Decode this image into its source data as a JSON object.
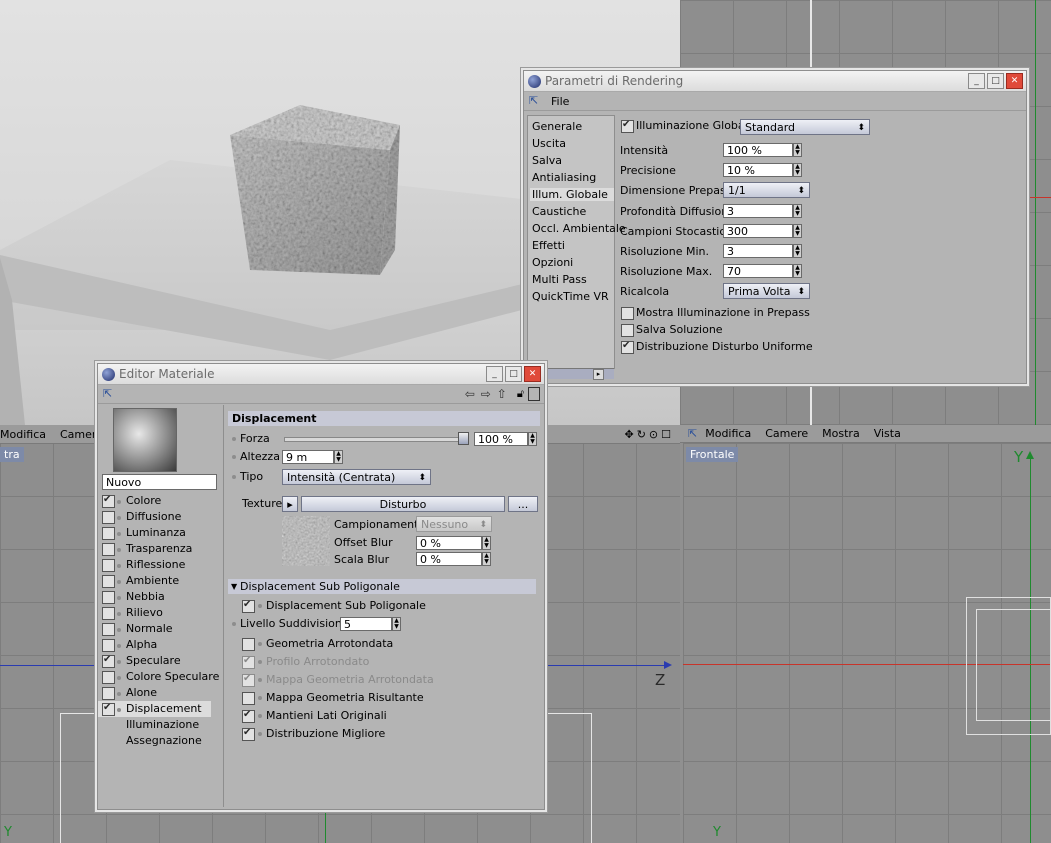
{
  "viewports": {
    "left_bottom": {
      "menu": [
        "Modifica",
        "Camere"
      ],
      "tag": "tra",
      "axis_z": "Z",
      "axis_y": "Y"
    },
    "right_bottom": {
      "menu": [
        "Modifica",
        "Camere",
        "Mostra",
        "Vista"
      ],
      "tag": "Frontale",
      "axis_y": "Y",
      "axis_y_bottom": "Y"
    },
    "right_top": {
      "axis_y": "Y"
    }
  },
  "render_settings": {
    "title": "Parametri di Rendering",
    "menu_file": "File",
    "sidebar": [
      "Generale",
      "Uscita",
      "Salva",
      "Antialiasing",
      "Illum. Globale",
      "Caustiche",
      "Occl. Ambientale",
      "Effetti",
      "Opzioni",
      "Multi Pass",
      "QuickTime VR"
    ],
    "gi_checkbox": "Illuminazione Globale",
    "gi_mode": "Standard",
    "rows": [
      {
        "label": "Intensità",
        "value": "100 %"
      },
      {
        "label": "Precisione",
        "value": "10 %"
      },
      {
        "label": "Dimensione Prepass",
        "value": "1/1"
      },
      {
        "label": "Profondità Diffusione",
        "value": "3"
      },
      {
        "label": "Campioni Stocastici",
        "value": "300"
      },
      {
        "label": "Risoluzione Min.",
        "value": "3"
      },
      {
        "label": "Risoluzione Max.",
        "value": "70"
      },
      {
        "label": "Ricalcola",
        "value": "Prima Volta"
      }
    ],
    "checks": [
      {
        "label": "Mostra Illuminazione in Prepass",
        "checked": false
      },
      {
        "label": "Salva Soluzione",
        "checked": false
      },
      {
        "label": "Distribuzione Disturbo Uniforme",
        "checked": true
      }
    ]
  },
  "material_editor": {
    "title": "Editor Materiale",
    "name": "Nuovo",
    "channels": [
      {
        "label": "Colore",
        "checked": true,
        "box": true
      },
      {
        "label": "Diffusione",
        "checked": false,
        "box": true
      },
      {
        "label": "Luminanza",
        "checked": false,
        "box": true
      },
      {
        "label": "Trasparenza",
        "checked": false,
        "box": true
      },
      {
        "label": "Riflessione",
        "checked": false,
        "box": true
      },
      {
        "label": "Ambiente",
        "checked": false,
        "box": true
      },
      {
        "label": "Nebbia",
        "checked": false,
        "box": true
      },
      {
        "label": "Rilievo",
        "checked": false,
        "box": true
      },
      {
        "label": "Normale",
        "checked": false,
        "box": true
      },
      {
        "label": "Alpha",
        "checked": false,
        "box": true
      },
      {
        "label": "Speculare",
        "checked": true,
        "box": true
      },
      {
        "label": "Colore Speculare",
        "checked": false,
        "box": true
      },
      {
        "label": "Alone",
        "checked": false,
        "box": true
      },
      {
        "label": "Displacement",
        "checked": true,
        "box": true
      },
      {
        "label": "Illuminazione",
        "checked": false,
        "box": false
      },
      {
        "label": "Assegnazione",
        "checked": false,
        "box": false
      }
    ],
    "section_title": "Displacement",
    "forza_label": "Forza",
    "forza_value": "100 %",
    "forza_fraction": 1.0,
    "altezza_label": "Altezza",
    "altezza_value": "9 m",
    "tipo_label": "Tipo",
    "tipo_value": "Intensità (Centrata)",
    "texture_label": "Texture",
    "texture_name": "Disturbo",
    "texture_more": "...",
    "campionamento_label": "Campionamento",
    "campionamento_value": "Nessuno",
    "offset_blur_label": "Offset Blur",
    "offset_blur_value": "0 %",
    "scala_blur_label": "Scala Blur",
    "scala_blur_value": "0 %",
    "subpoly_section": "Displacement Sub Poligonale",
    "subpoly_checks": [
      {
        "label": "Displacement Sub Poligonale",
        "checked": true,
        "dim": false
      }
    ],
    "livello_label": "Livello Suddivisione",
    "livello_value": "5",
    "more_checks": [
      {
        "label": "Geometria Arrotondata",
        "checked": false,
        "dim": false
      },
      {
        "label": "Profilo Arrotondato",
        "checked": true,
        "dim": true
      },
      {
        "label": "Mappa Geometria Arrotondata",
        "checked": true,
        "dim": true
      },
      {
        "label": "Mappa Geometria Risultante",
        "checked": false,
        "dim": false
      },
      {
        "label": "Mantieni Lati Originali",
        "checked": true,
        "dim": false
      },
      {
        "label": "Distribuzione Migliore",
        "checked": true,
        "dim": false
      }
    ]
  },
  "colors": {
    "window_bg": "#b4b4b4",
    "accent": "#7d8aa8",
    "axis_red": "#c8342a",
    "axis_green": "#1f8a2e",
    "axis_blue": "#2a3bb0"
  }
}
